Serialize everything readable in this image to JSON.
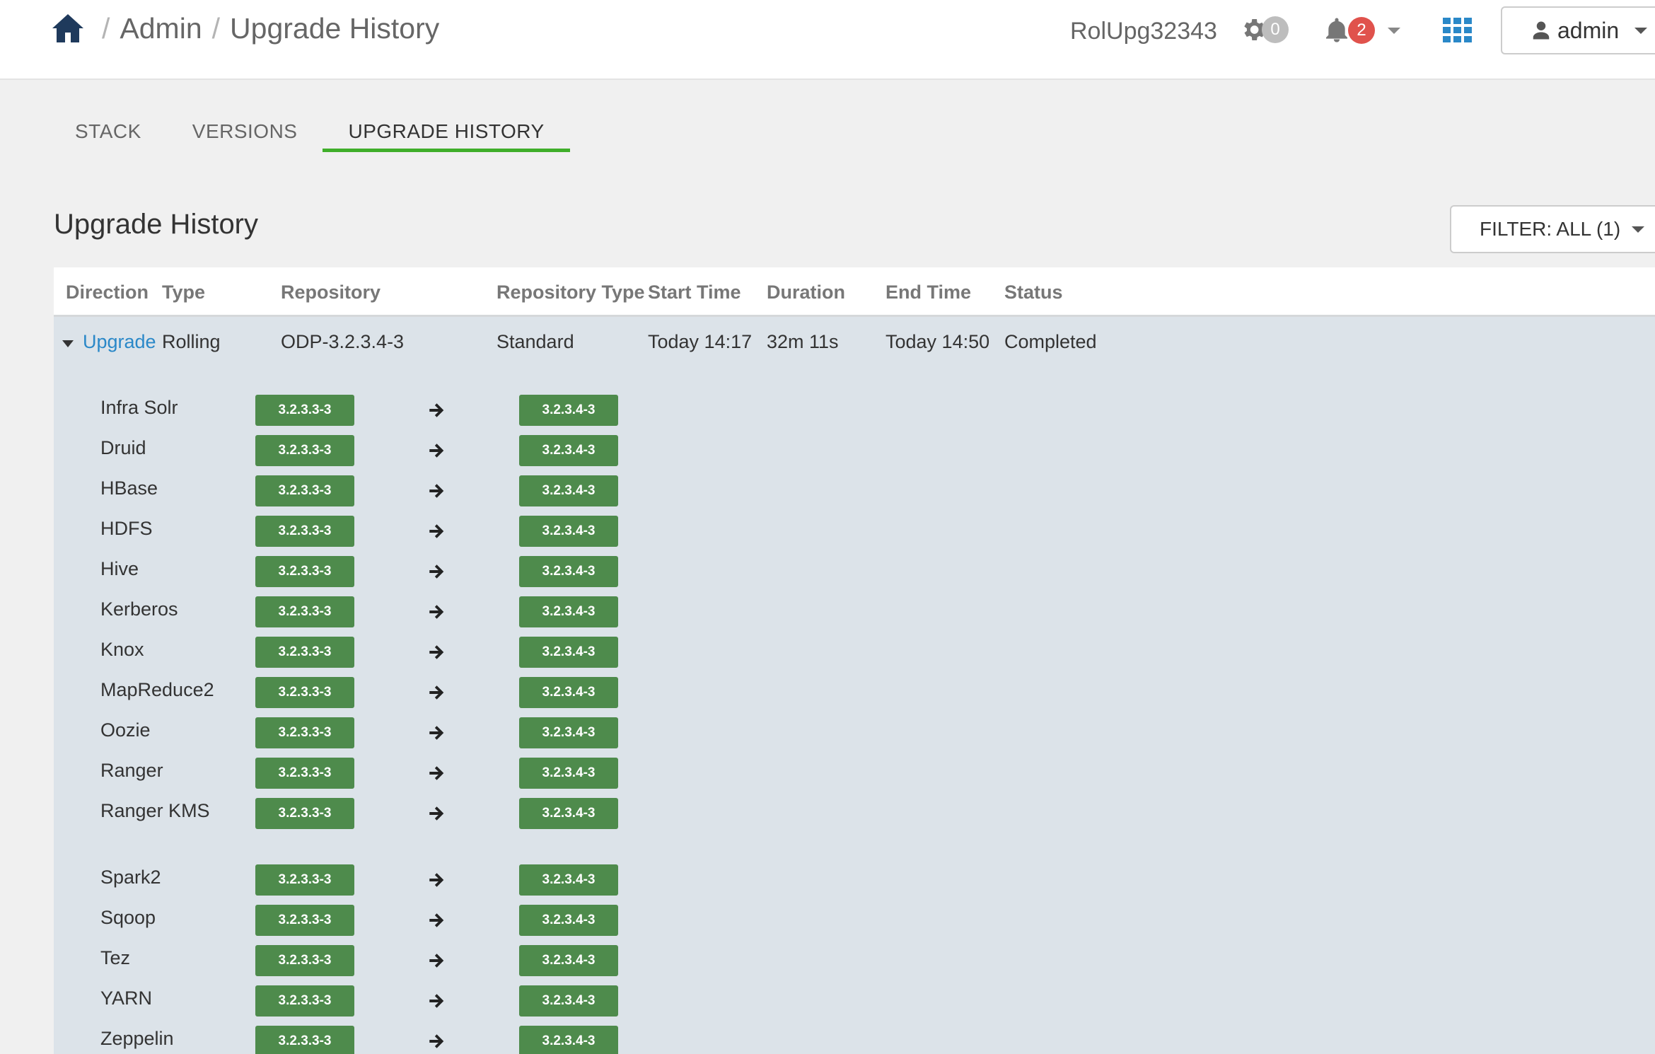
{
  "breadcrumb": {
    "items": [
      "Admin",
      "Upgrade History"
    ],
    "separator": "/"
  },
  "header": {
    "cluster_name": "RolUpg32343",
    "ops_count": "0",
    "alerts_count": "2",
    "user_label": "admin"
  },
  "tabs": [
    {
      "label": "STACK",
      "active": false
    },
    {
      "label": "VERSIONS",
      "active": false
    },
    {
      "label": "UPGRADE HISTORY",
      "active": true
    }
  ],
  "page": {
    "title": "Upgrade History",
    "filter_label": "FILTER: ALL (1)"
  },
  "table": {
    "columns": [
      "Direction",
      "Type",
      "Repository",
      "Repository Type",
      "Start Time",
      "Duration",
      "End Time",
      "Status"
    ],
    "row": {
      "direction": "Upgrade",
      "type": "Rolling",
      "repository": "ODP-3.2.3.4-3",
      "repository_type": "Standard",
      "start_time": "Today 14:17",
      "duration": "32m 11s",
      "end_time": "Today 14:50",
      "status": "Completed"
    },
    "services": [
      {
        "name": "Infra Solr",
        "from": "3.2.3.3-3",
        "to": "3.2.3.4-3"
      },
      {
        "name": "Druid",
        "from": "3.2.3.3-3",
        "to": "3.2.3.4-3"
      },
      {
        "name": "HBase",
        "from": "3.2.3.3-3",
        "to": "3.2.3.4-3"
      },
      {
        "name": "HDFS",
        "from": "3.2.3.3-3",
        "to": "3.2.3.4-3"
      },
      {
        "name": "Hive",
        "from": "3.2.3.3-3",
        "to": "3.2.3.4-3"
      },
      {
        "name": "Kerberos",
        "from": "3.2.3.3-3",
        "to": "3.2.3.4-3"
      },
      {
        "name": "Knox",
        "from": "3.2.3.3-3",
        "to": "3.2.3.4-3"
      },
      {
        "name": "MapReduce2",
        "from": "3.2.3.3-3",
        "to": "3.2.3.4-3"
      },
      {
        "name": "Oozie",
        "from": "3.2.3.3-3",
        "to": "3.2.3.4-3"
      },
      {
        "name": "Ranger",
        "from": "3.2.3.3-3",
        "to": "3.2.3.4-3"
      },
      {
        "name": "Ranger KMS",
        "from": "3.2.3.3-3",
        "to": "3.2.3.4-3"
      },
      {
        "name": "Spark2",
        "from": "3.2.3.3-3",
        "to": "3.2.3.4-3"
      },
      {
        "name": "Sqoop",
        "from": "3.2.3.3-3",
        "to": "3.2.3.4-3"
      },
      {
        "name": "Tez",
        "from": "3.2.3.3-3",
        "to": "3.2.3.4-3"
      },
      {
        "name": "YARN",
        "from": "3.2.3.3-3",
        "to": "3.2.3.4-3"
      },
      {
        "name": "Zeppelin",
        "from": "3.2.3.3-3",
        "to": "3.2.3.4-3"
      }
    ]
  },
  "colors": {
    "accent_tab": "#3fae2a",
    "version_badge": "#4e8b4c",
    "link": "#2a88c8",
    "alert_badge": "#e0524c"
  },
  "icons": [
    "home-icon",
    "gear-icon",
    "bell-icon",
    "apps-grid-icon",
    "user-icon",
    "arrow-right-icon"
  ]
}
